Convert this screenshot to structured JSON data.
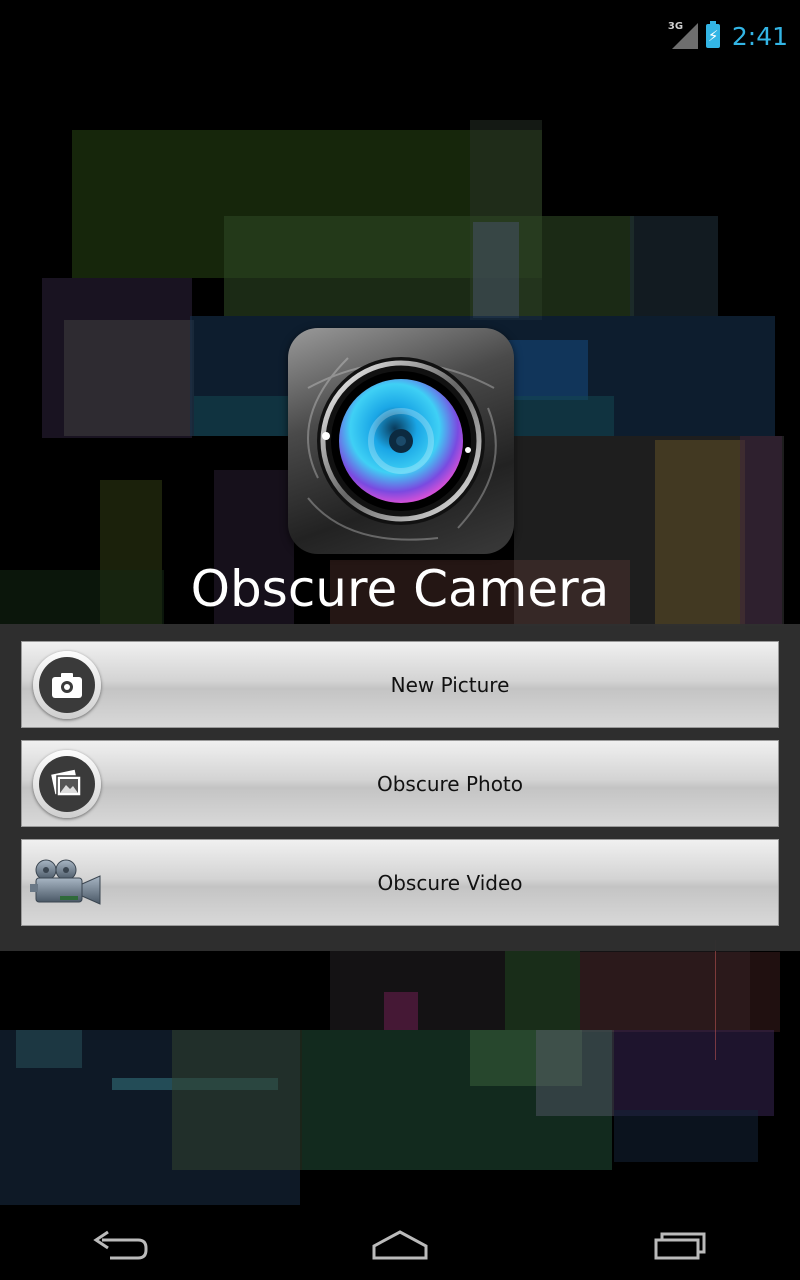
{
  "status_bar": {
    "network": "3G",
    "time": "2:41"
  },
  "app": {
    "title": "Obscure Camera",
    "icon": "camera-lens-icon"
  },
  "menu": {
    "items": [
      {
        "label": "New Picture",
        "icon": "camera-icon"
      },
      {
        "label": "Obscure Photo",
        "icon": "photo-gallery-icon"
      },
      {
        "label": "Obscure Video",
        "icon": "video-camera-icon"
      }
    ]
  },
  "nav": {
    "back": "back-icon",
    "home": "home-icon",
    "recent": "recent-apps-icon"
  },
  "colors": {
    "accent": "#33b5e5",
    "panel": "#303030",
    "button": "#d4d4d4"
  }
}
